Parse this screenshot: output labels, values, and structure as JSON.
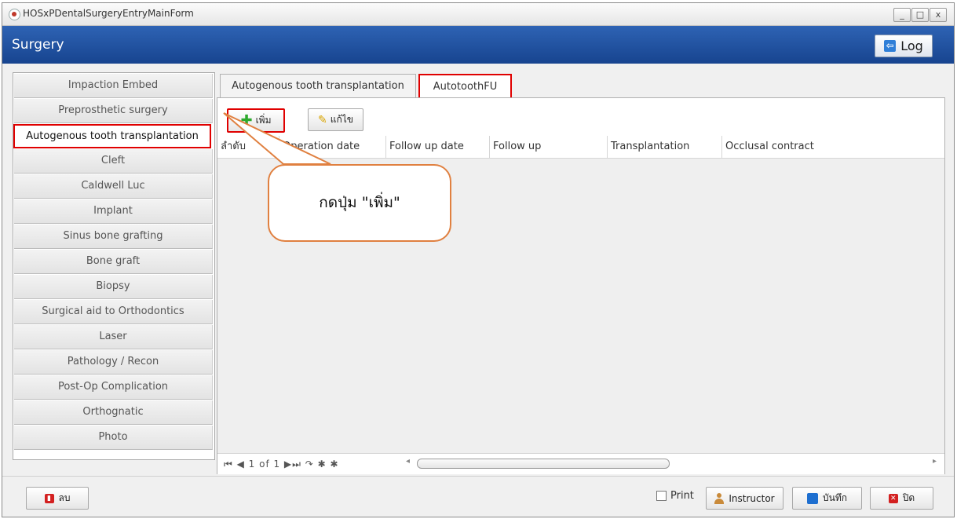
{
  "window": {
    "title": "HOSxPDentalSurgeryEntryMainForm",
    "controls": [
      "_",
      "□",
      "x"
    ]
  },
  "header": {
    "title": "Surgery",
    "log_label": "Log",
    "log_icon": "exit-icon"
  },
  "sidebar": {
    "items": [
      {
        "label": "Impaction Embed"
      },
      {
        "label": "Preprosthetic surgery"
      },
      {
        "label": "Autogenous tooth transplantation",
        "active": true
      },
      {
        "label": "Cleft"
      },
      {
        "label": "Caldwell Luc"
      },
      {
        "label": "Implant"
      },
      {
        "label": "Sinus bone grafting"
      },
      {
        "label": "Bone graft"
      },
      {
        "label": "Biopsy"
      },
      {
        "label": "Surgical aid to Orthodontics"
      },
      {
        "label": "Laser"
      },
      {
        "label": "Pathology / Recon"
      },
      {
        "label": "Post-Op Complication"
      },
      {
        "label": "Orthognatic"
      },
      {
        "label": "Photo"
      }
    ]
  },
  "tabs": [
    {
      "label": "Autogenous tooth transplantation"
    },
    {
      "label": "AutotoothFU",
      "active": true
    }
  ],
  "toolbar": {
    "add_label": "เพิ่ม",
    "edit_label": "แก้ไข"
  },
  "grid": {
    "columns": [
      "ลำดับ",
      "Operation date",
      "Follow up date",
      "Follow up",
      "Transplantation",
      "Occlusal contract"
    ],
    "rows": []
  },
  "navigator": {
    "text": "⏮ ◀ 1 of 1 ▶⏭ ↷ ✱ ✱"
  },
  "callout": {
    "text": "กดปุ่ม \"เพิ่ม\""
  },
  "footer": {
    "delete_label": "ลบ",
    "print_label": "Print",
    "instructor_label": "Instructor",
    "save_label": "บันทึก",
    "close_label": "ปิด"
  },
  "colors": {
    "header_blue": "#1f4f9e",
    "highlight_red": "#e00000",
    "callout_orange": "#e08040"
  }
}
